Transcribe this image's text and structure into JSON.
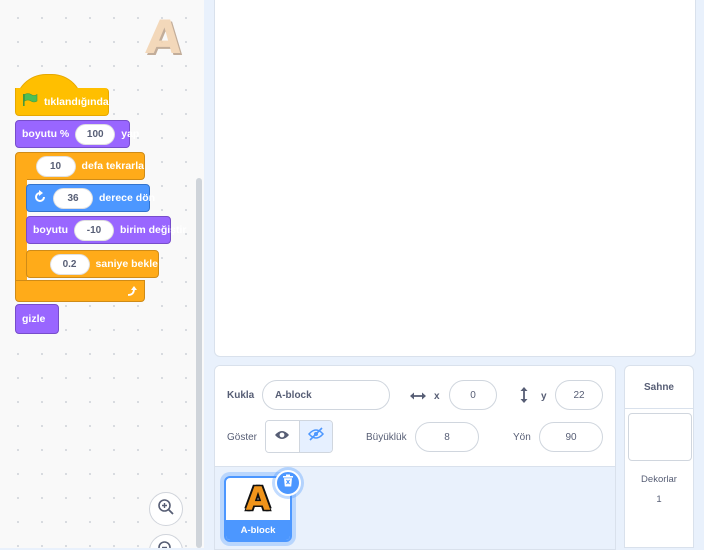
{
  "code": {
    "blocks": {
      "when_flag": "tıklandığında",
      "set_size_label": "boyutu %",
      "set_size_value": "100",
      "set_size_suffix": "yap",
      "repeat_count": "10",
      "repeat_label": "defa tekrarla",
      "turn_value": "36",
      "turn_label": "derece dön",
      "change_size_label": "boyutu",
      "change_size_value": "-10",
      "change_size_suffix": "birim değiştir",
      "wait_value": "0.2",
      "wait_label": "saniye bekle",
      "hide_label": "gizle"
    },
    "sprite_preview_icon": "A"
  },
  "sprite_info": {
    "sprite_label": "Kukla",
    "sprite_name": "A-block",
    "x_label": "x",
    "x_value": "0",
    "y_label": "y",
    "y_value": "22",
    "show_label": "Göster",
    "size_label": "Büyüklük",
    "size_value": "8",
    "direction_label": "Yön",
    "direction_value": "90"
  },
  "sprites": [
    {
      "name": "A-block",
      "thumb": "A"
    }
  ],
  "stage_panel": {
    "title": "Sahne",
    "backdrops_label": "Dekorlar",
    "backdrops_count": "1"
  },
  "colors": {
    "events": "#ffbf00",
    "looks": "#9966ff",
    "control": "#ffab19",
    "motion": "#4c97ff",
    "accent": "#4c97ff"
  }
}
